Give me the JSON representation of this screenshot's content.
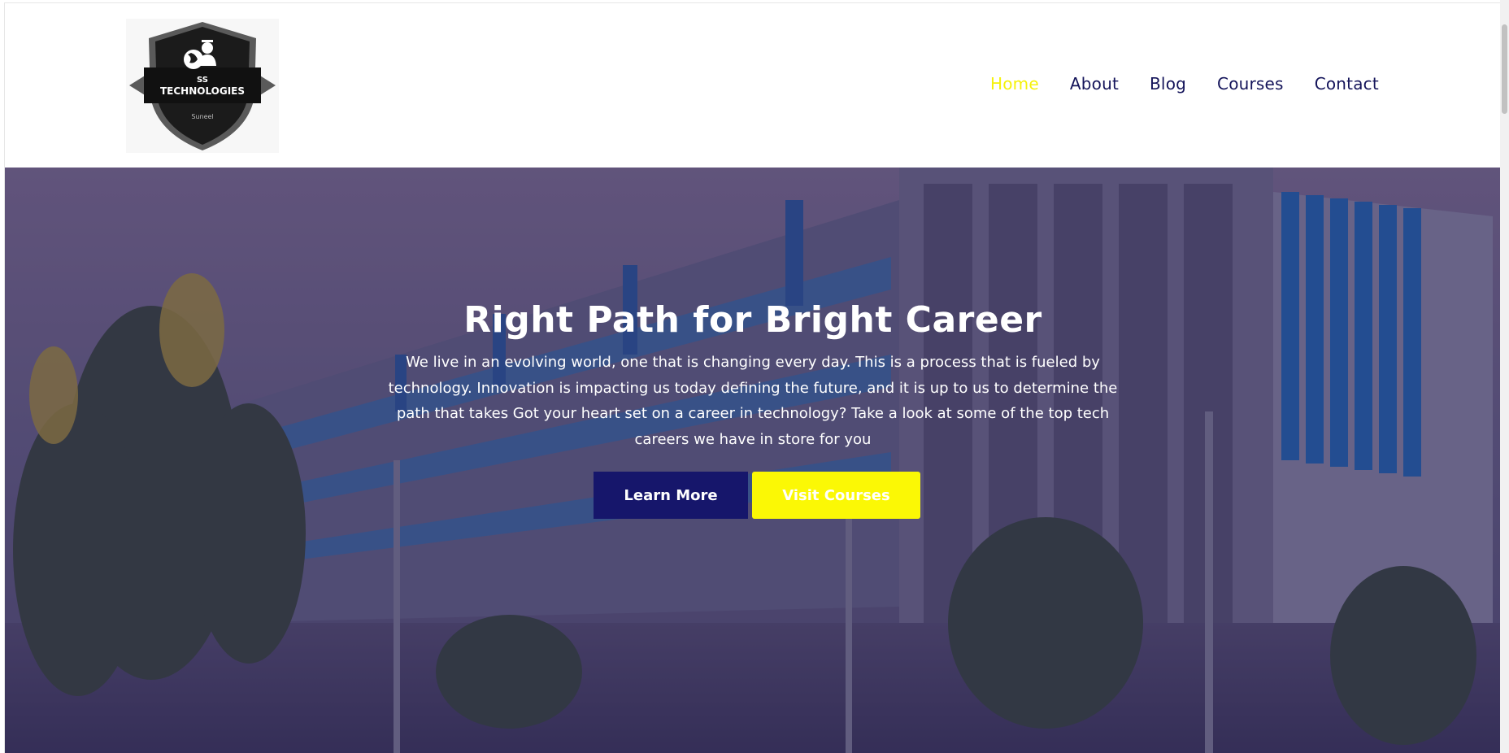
{
  "header": {
    "logo": {
      "line1": "SS",
      "line2": "TECHNOLOGIES",
      "line3": "Suneel"
    },
    "nav": [
      {
        "label": "Home",
        "active": true
      },
      {
        "label": "About",
        "active": false
      },
      {
        "label": "Blog",
        "active": false
      },
      {
        "label": "Courses",
        "active": false
      },
      {
        "label": "Contact",
        "active": false
      }
    ]
  },
  "hero": {
    "title": "Right Path for Bright Career",
    "text": "We live in an evolving world, one that is changing every day. This is a process that is fueled by technology. Innovation is impacting us today defining the future, and it is up to us to determine the path that takes Got your heart set on a career in technology? Take a look at some of the top tech careers we have in store for you",
    "learn_more": "Learn More",
    "visit_courses": "Visit Courses"
  },
  "colors": {
    "nav_text": "#14145a",
    "nav_active": "#f5f20a",
    "primary_button": "#16166b",
    "accent_button": "#fbf805"
  }
}
